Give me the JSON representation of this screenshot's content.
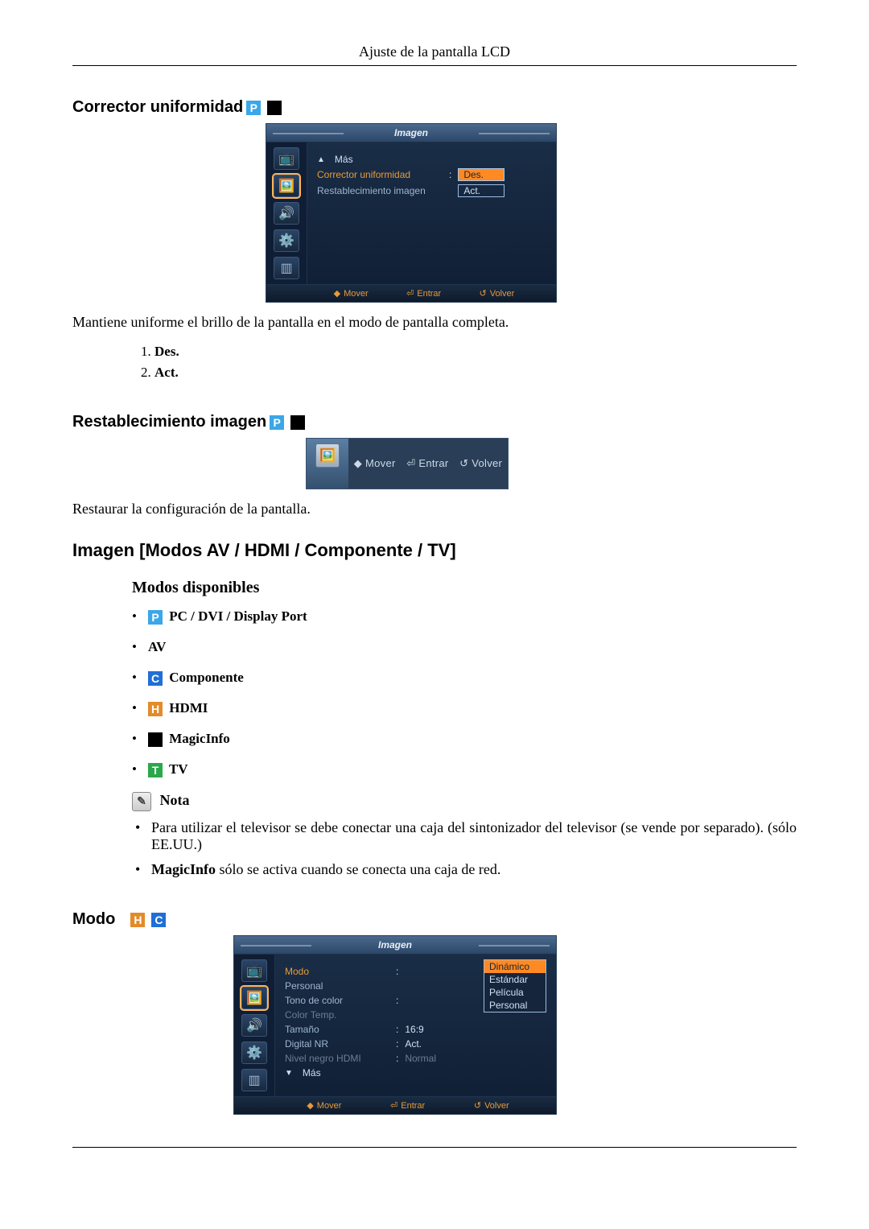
{
  "header": {
    "title": "Ajuste de la pantalla LCD"
  },
  "corrector": {
    "heading": "Corrector uniformidad",
    "desc": "Mantiene uniforme el brillo de la pantalla en el modo de pantalla completa.",
    "opts": [
      "Des.",
      "Act."
    ],
    "osd": {
      "title": "Imagen",
      "mas": "Más",
      "row1": "Corrector uniformidad",
      "row1sel": "Des.",
      "row2": "Restablecimiento imagen",
      "row2sel": "Act.",
      "footer": {
        "move": "Mover",
        "enter": "Entrar",
        "back": "Volver"
      }
    }
  },
  "restab": {
    "heading": "Restablecimiento imagen",
    "desc": "Restaurar la configuración de la pantalla.",
    "osd": {
      "move": "Mover",
      "enter": "Entrar",
      "back": "Volver"
    }
  },
  "imagen_modes": {
    "heading": "Imagen [Modos AV / HDMI / Componente / TV]",
    "sub": "Modos disponibles",
    "items": {
      "pc": "PC / DVI / Display Port",
      "av": "AV",
      "comp": "Componente",
      "hdmi": "HDMI",
      "magic": "MagicInfo",
      "tv": "TV"
    },
    "nota_label": "Nota",
    "nota1": "Para utilizar el televisor se debe conectar una caja del sintonizador del televisor (se vende por separado). (sólo EE.UU.)",
    "nota2_b": "MagicInfo",
    "nota2_r": " sólo se activa cuando se conecta una caja de red."
  },
  "modo": {
    "heading": "Modo",
    "osd": {
      "title": "Imagen",
      "rows": {
        "modo": {
          "label": "Modo",
          "val": "Dinámico"
        },
        "pers": {
          "label": "Personal",
          "val": "Estándar"
        },
        "tono": {
          "label": "Tono de color",
          "val": "Película"
        },
        "ct": {
          "label": "Color Temp.",
          "val": "Personal"
        },
        "tam": {
          "label": "Tamaño",
          "val": "16:9"
        },
        "dnr": {
          "label": "Digital NR",
          "val": "Act."
        },
        "nnh": {
          "label": "Nivel negro HDMI",
          "val": "Normal"
        }
      },
      "dropdown": [
        "Dinámico",
        "Estándar",
        "Película",
        "Personal"
      ],
      "mas": "Más",
      "footer": {
        "move": "Mover",
        "enter": "Entrar",
        "back": "Volver"
      }
    }
  }
}
